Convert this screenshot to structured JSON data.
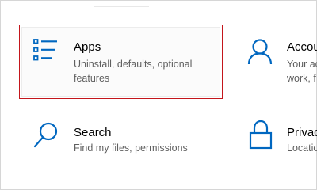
{
  "tiles": {
    "apps": {
      "title": "Apps",
      "description": "Uninstall, defaults, optional features",
      "icon": "apps-list-icon"
    },
    "accounts": {
      "title": "Accou",
      "description_line1": "Your ac",
      "description_line2": "work, f",
      "icon": "person-icon"
    },
    "search": {
      "title": "Search",
      "description": "Find my files, permissions",
      "icon": "search-icon"
    },
    "privacy": {
      "title": "Privac",
      "description": "Locatio",
      "icon": "lock-icon"
    }
  },
  "colors": {
    "accent": "#0067c0",
    "selection_border": "#c4161c",
    "description_text": "#5f5f5f"
  }
}
